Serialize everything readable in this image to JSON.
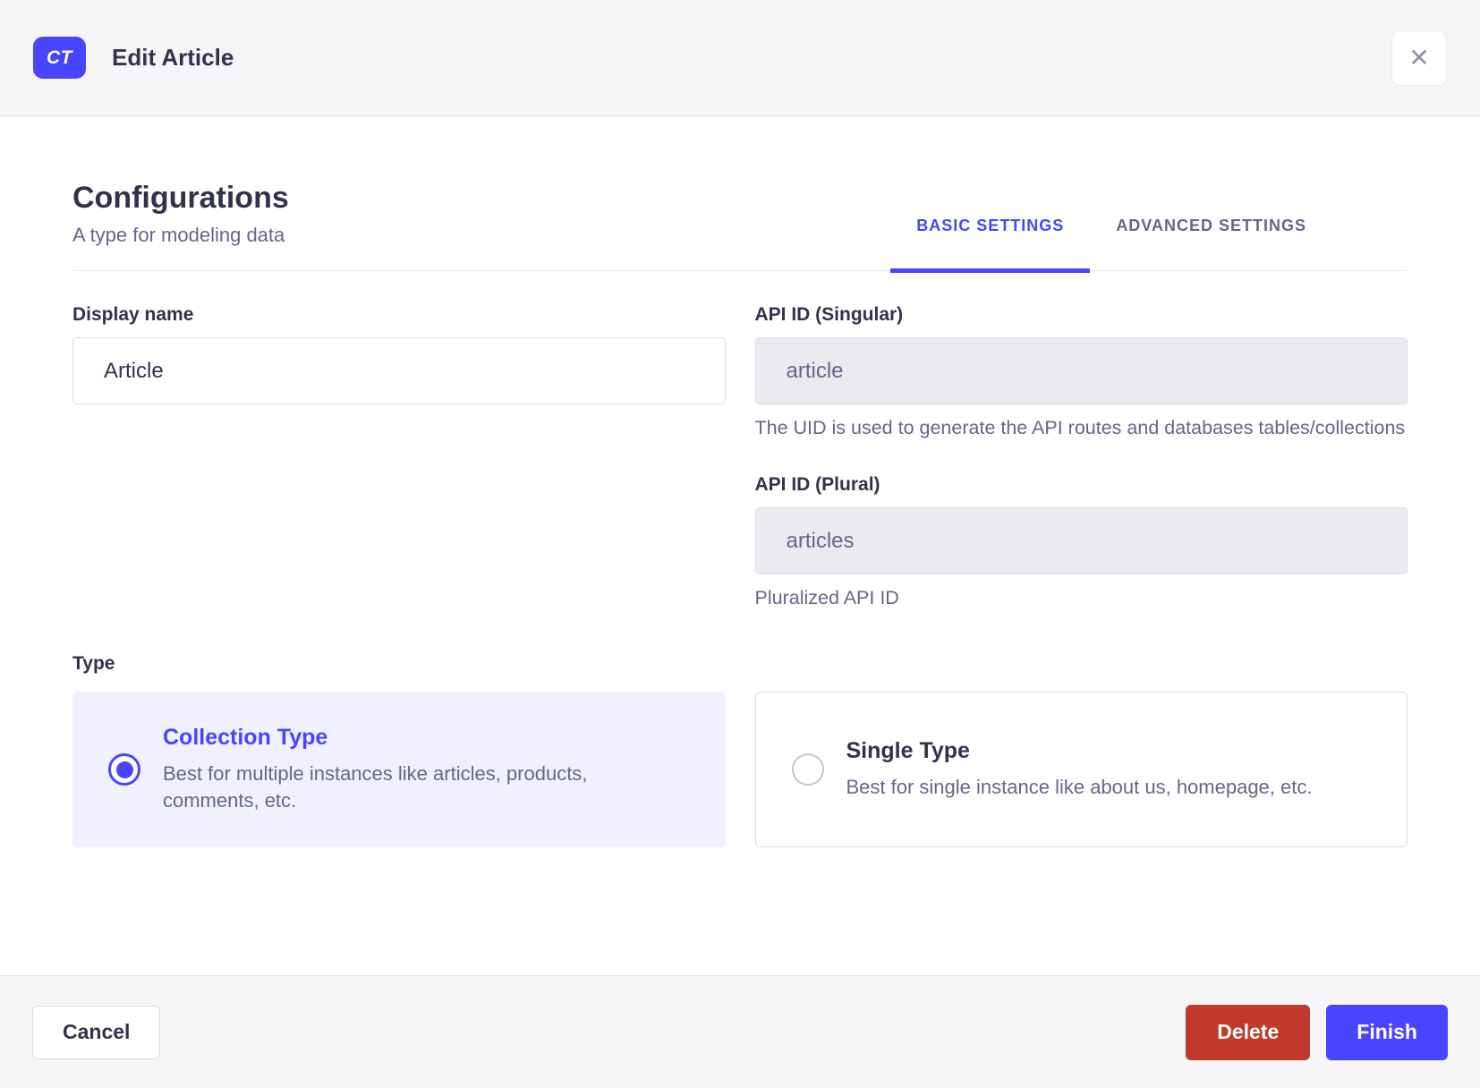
{
  "colors": {
    "primary": "#4945ff",
    "primary_bg": "#f0f0ff",
    "danger": "#c0392b"
  },
  "icons": {
    "close": "✕"
  },
  "header": {
    "badge": "CT",
    "title": "Edit Article"
  },
  "section": {
    "title": "Configurations",
    "subtitle": "A type for modeling data"
  },
  "tabs": [
    {
      "label": "BASIC SETTINGS",
      "active": true
    },
    {
      "label": "ADVANCED SETTINGS",
      "active": false
    }
  ],
  "fields": {
    "display_name": {
      "label": "Display name",
      "value": "Article"
    },
    "api_singular": {
      "label": "API ID (Singular)",
      "value": "article",
      "help": "The UID is used to generate the API routes and databases tables/collections"
    },
    "api_plural": {
      "label": "API ID (Plural)",
      "value": "articles",
      "help": "Pluralized API ID"
    }
  },
  "type": {
    "label": "Type",
    "options": [
      {
        "title": "Collection Type",
        "description": "Best for multiple instances like articles, products, comments, etc.",
        "selected": true
      },
      {
        "title": "Single Type",
        "description": "Best for single instance like about us, homepage, etc.",
        "selected": false
      }
    ]
  },
  "footer": {
    "cancel": "Cancel",
    "delete": "Delete",
    "finish": "Finish"
  }
}
